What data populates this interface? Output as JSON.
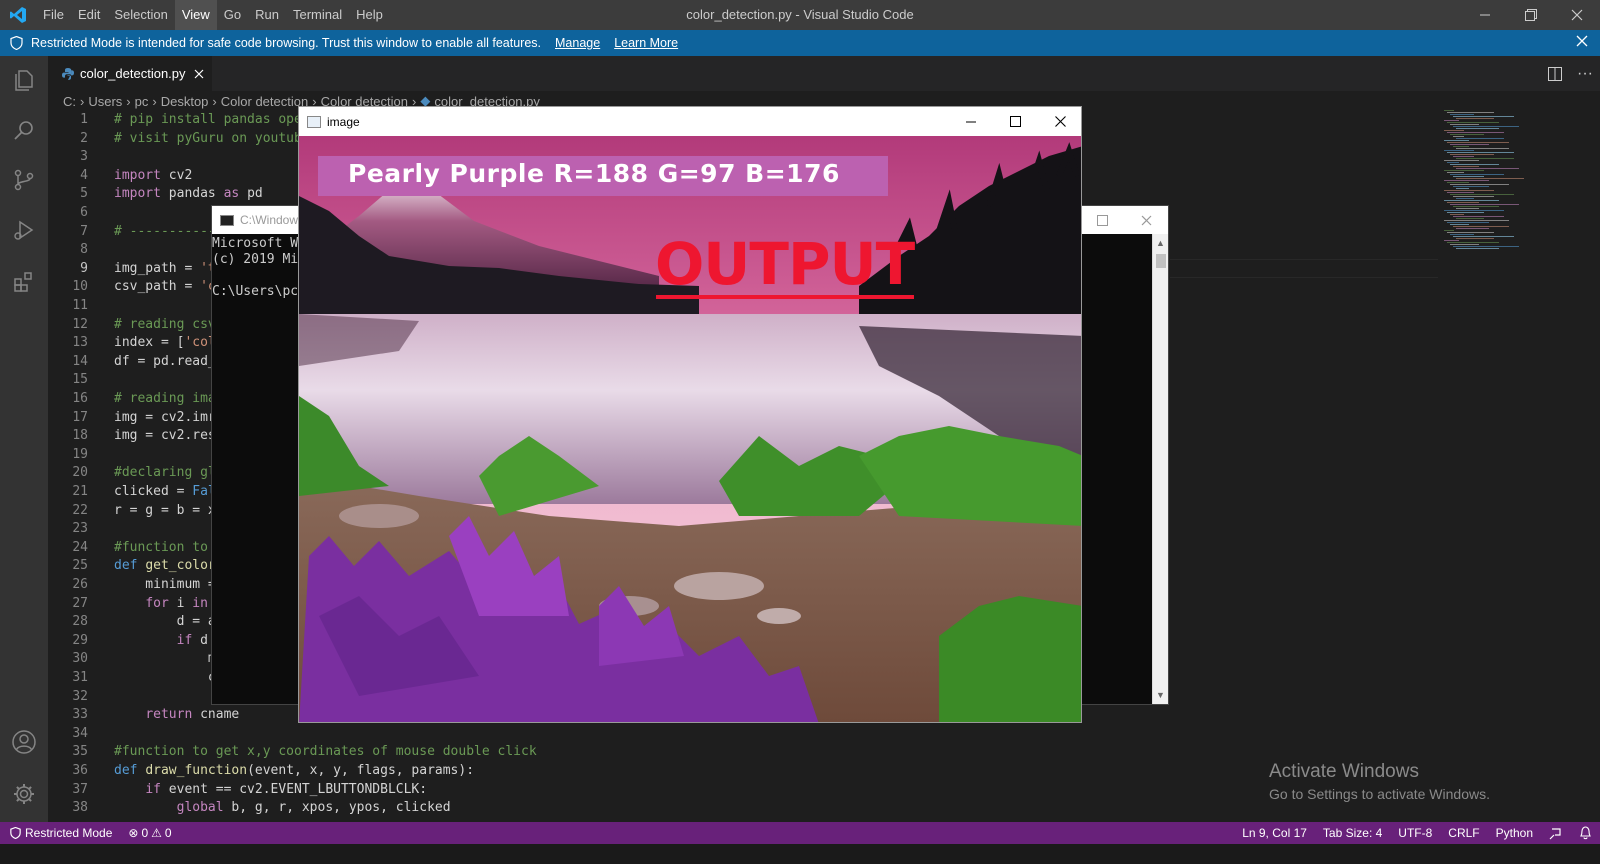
{
  "window": {
    "title": "color_detection.py - Visual Studio Code"
  },
  "menu": [
    "File",
    "Edit",
    "Selection",
    "View",
    "Go",
    "Run",
    "Terminal",
    "Help"
  ],
  "banner": {
    "text": "Restricted Mode is intended for safe code browsing. Trust this window to enable all features.",
    "manage": "Manage",
    "learn_more": "Learn More"
  },
  "tab": {
    "label": "color_detection.py"
  },
  "breadcrumb": [
    "C:",
    "Users",
    "pc",
    "Desktop",
    "Color detection",
    "Color detection",
    "color_detection.py"
  ],
  "code_lines": [
    {
      "n": "1",
      "t": "# pip install pandas opencv-python"
    },
    {
      "n": "2",
      "t": "# visit pyGuru on youtube"
    },
    {
      "n": "3",
      "t": ""
    },
    {
      "n": "4",
      "t": "import cv2"
    },
    {
      "n": "5",
      "t": "import pandas as pd"
    },
    {
      "n": "6",
      "t": ""
    },
    {
      "n": "7",
      "t": "# -----------"
    },
    {
      "n": "8",
      "t": ""
    },
    {
      "n": "9",
      "t": "img_path = 't"
    },
    {
      "n": "10",
      "t": "csv_path = 'c"
    },
    {
      "n": "11",
      "t": ""
    },
    {
      "n": "12",
      "t": "# reading csv"
    },
    {
      "n": "13",
      "t": "index = ['col"
    },
    {
      "n": "14",
      "t": "df = pd.read_"
    },
    {
      "n": "15",
      "t": ""
    },
    {
      "n": "16",
      "t": "# reading ima"
    },
    {
      "n": "17",
      "t": "img = cv2.imr"
    },
    {
      "n": "18",
      "t": "img = cv2.res"
    },
    {
      "n": "19",
      "t": ""
    },
    {
      "n": "20",
      "t": "#declaring gl"
    },
    {
      "n": "21",
      "t": "clicked = Fal"
    },
    {
      "n": "22",
      "t": "r = g = b = x"
    },
    {
      "n": "23",
      "t": ""
    },
    {
      "n": "24",
      "t": "#function to"
    },
    {
      "n": "25",
      "t": "def get_color"
    },
    {
      "n": "26",
      "t": "    minimum ="
    },
    {
      "n": "27",
      "t": "    for i in"
    },
    {
      "n": "28",
      "t": "        d = a"
    },
    {
      "n": "29",
      "t": "        if d"
    },
    {
      "n": "30",
      "t": "            m"
    },
    {
      "n": "31",
      "t": "            c"
    },
    {
      "n": "32",
      "t": ""
    },
    {
      "n": "33",
      "t": "    return cname"
    },
    {
      "n": "34",
      "t": ""
    },
    {
      "n": "35",
      "t": "#function to get x,y coordinates of mouse double click"
    },
    {
      "n": "36",
      "t": "def draw_function(event, x, y, flags, params):"
    },
    {
      "n": "37",
      "t": "    if event == cv2.EVENT_LBUTTONDBLCLK:"
    },
    {
      "n": "38",
      "t": "        global b, g, r, xpos, ypos, clicked"
    }
  ],
  "console": {
    "title": "C:\\Window",
    "lines": [
      "Microsoft W",
      "(c) 2019 Mi",
      "",
      "C:\\Users\\pc"
    ]
  },
  "image_window": {
    "title": "image",
    "color_label": "Pearly Purple R=188 G=97 B=176",
    "color_rgb": "#bc61b0",
    "overlay_text": "OUTPUT"
  },
  "watermark": {
    "title": "Activate Windows",
    "subtitle": "Go to Settings to activate Windows."
  },
  "status": {
    "mode": "Restricted Mode",
    "errors": "0",
    "warnings": "0",
    "position": "Ln 9, Col 17",
    "tab_size": "Tab Size: 4",
    "encoding": "UTF-8",
    "eol": "CRLF",
    "language": "Python"
  },
  "colors": {
    "titlebar": "#3c3c3c",
    "banner": "#0e639c",
    "activity": "#333333",
    "editor": "#1e1e1e",
    "status": "#68217a",
    "output_red": "#ee1630"
  }
}
